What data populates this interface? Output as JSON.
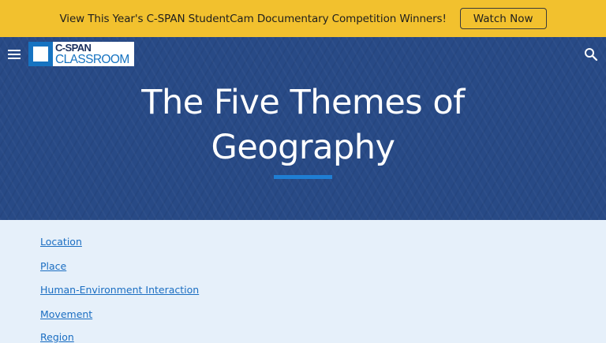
{
  "announcement": {
    "text": "View This Year's C-SPAN StudentCam Documentary Competition Winners!",
    "button_label": "Watch Now"
  },
  "header": {
    "logo_top": "C-SPAN",
    "logo_bottom": "CLASSROOM",
    "menu_icon": "hamburger-menu-icon",
    "search_icon": "search-icon"
  },
  "hero": {
    "title_line1": "The Five Themes of",
    "title_line2": "Geography"
  },
  "themes": [
    {
      "label": "Location"
    },
    {
      "label": "Place"
    },
    {
      "label": "Human-Environment Interaction"
    },
    {
      "label": "Movement"
    },
    {
      "label": "Region"
    }
  ],
  "colors": {
    "announcement_bg": "#f2c12e",
    "hero_bg": "#2b4f8c",
    "accent": "#1f7ed3",
    "link": "#1b6ec2",
    "page_bg": "#e6f0fa"
  }
}
